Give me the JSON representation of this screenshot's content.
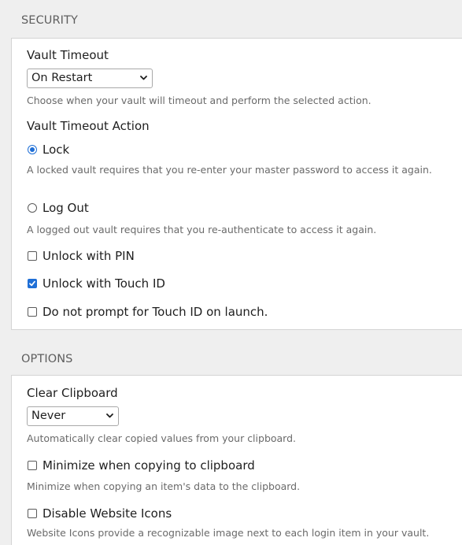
{
  "security": {
    "header": "SECURITY",
    "vault_timeout": {
      "label": "Vault Timeout",
      "selected": "On Restart",
      "help": "Choose when your vault will timeout and perform the selected action."
    },
    "vault_timeout_action": {
      "label": "Vault Timeout Action",
      "lock": {
        "label": "Lock",
        "checked": true,
        "help": "A locked vault requires that you re-enter your master password to access it again."
      },
      "logout": {
        "label": "Log Out",
        "checked": false,
        "help": "A logged out vault requires that you re-authenticate to access it again."
      }
    },
    "unlock_pin": {
      "label": "Unlock with PIN",
      "checked": false
    },
    "unlock_touch_id": {
      "label": "Unlock with Touch ID",
      "checked": true
    },
    "no_prompt_touch_id": {
      "label": "Do not prompt for Touch ID on launch.",
      "checked": false
    }
  },
  "options": {
    "header": "OPTIONS",
    "clear_clipboard": {
      "label": "Clear Clipboard",
      "selected": "Never",
      "help": "Automatically clear copied values from your clipboard."
    },
    "minimize_copy": {
      "label": "Minimize when copying to clipboard",
      "checked": false,
      "help": "Minimize when copying an item's data to the clipboard."
    },
    "disable_icons": {
      "label": "Disable Website Icons",
      "checked": false,
      "help": "Website Icons provide a recognizable image next to each login item in your vault."
    }
  },
  "colors": {
    "accent": "#1f6fd6",
    "background": "#efefef",
    "panel": "#ffffff",
    "help_text": "#6a6a6a"
  }
}
